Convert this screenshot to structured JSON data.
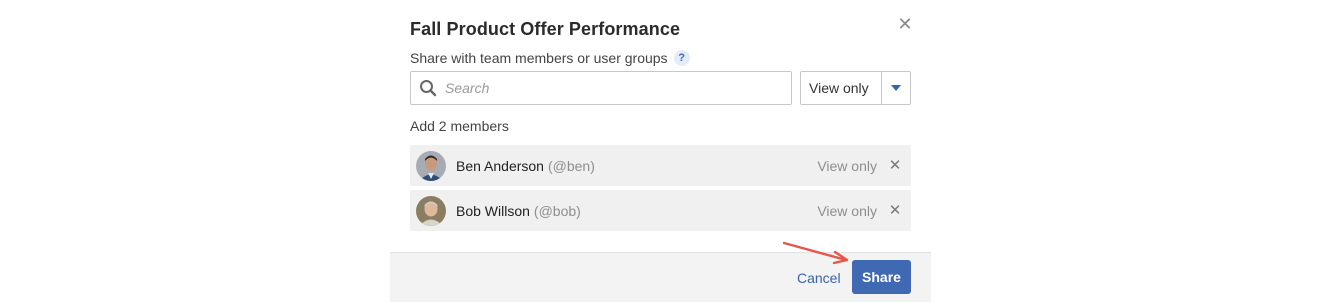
{
  "dialog": {
    "title": "Fall Product Offer Performance",
    "close_icon": "close-icon",
    "subtitle": "Share with team members or user groups",
    "help_glyph": "?"
  },
  "search": {
    "placeholder": "Search",
    "value": ""
  },
  "permission": {
    "selected": "View only"
  },
  "add_count_label": "Add 2 members",
  "members": [
    {
      "name": "Ben Anderson",
      "handle": "(@ben)",
      "permission": "View only"
    },
    {
      "name": "Bob Willson",
      "handle": "(@bob)",
      "permission": "View only"
    }
  ],
  "footer": {
    "cancel_label": "Cancel",
    "share_label": "Share"
  },
  "colors": {
    "accent": "#3f69b2",
    "link": "#3a63a8",
    "annotation_arrow": "#e4574b"
  }
}
